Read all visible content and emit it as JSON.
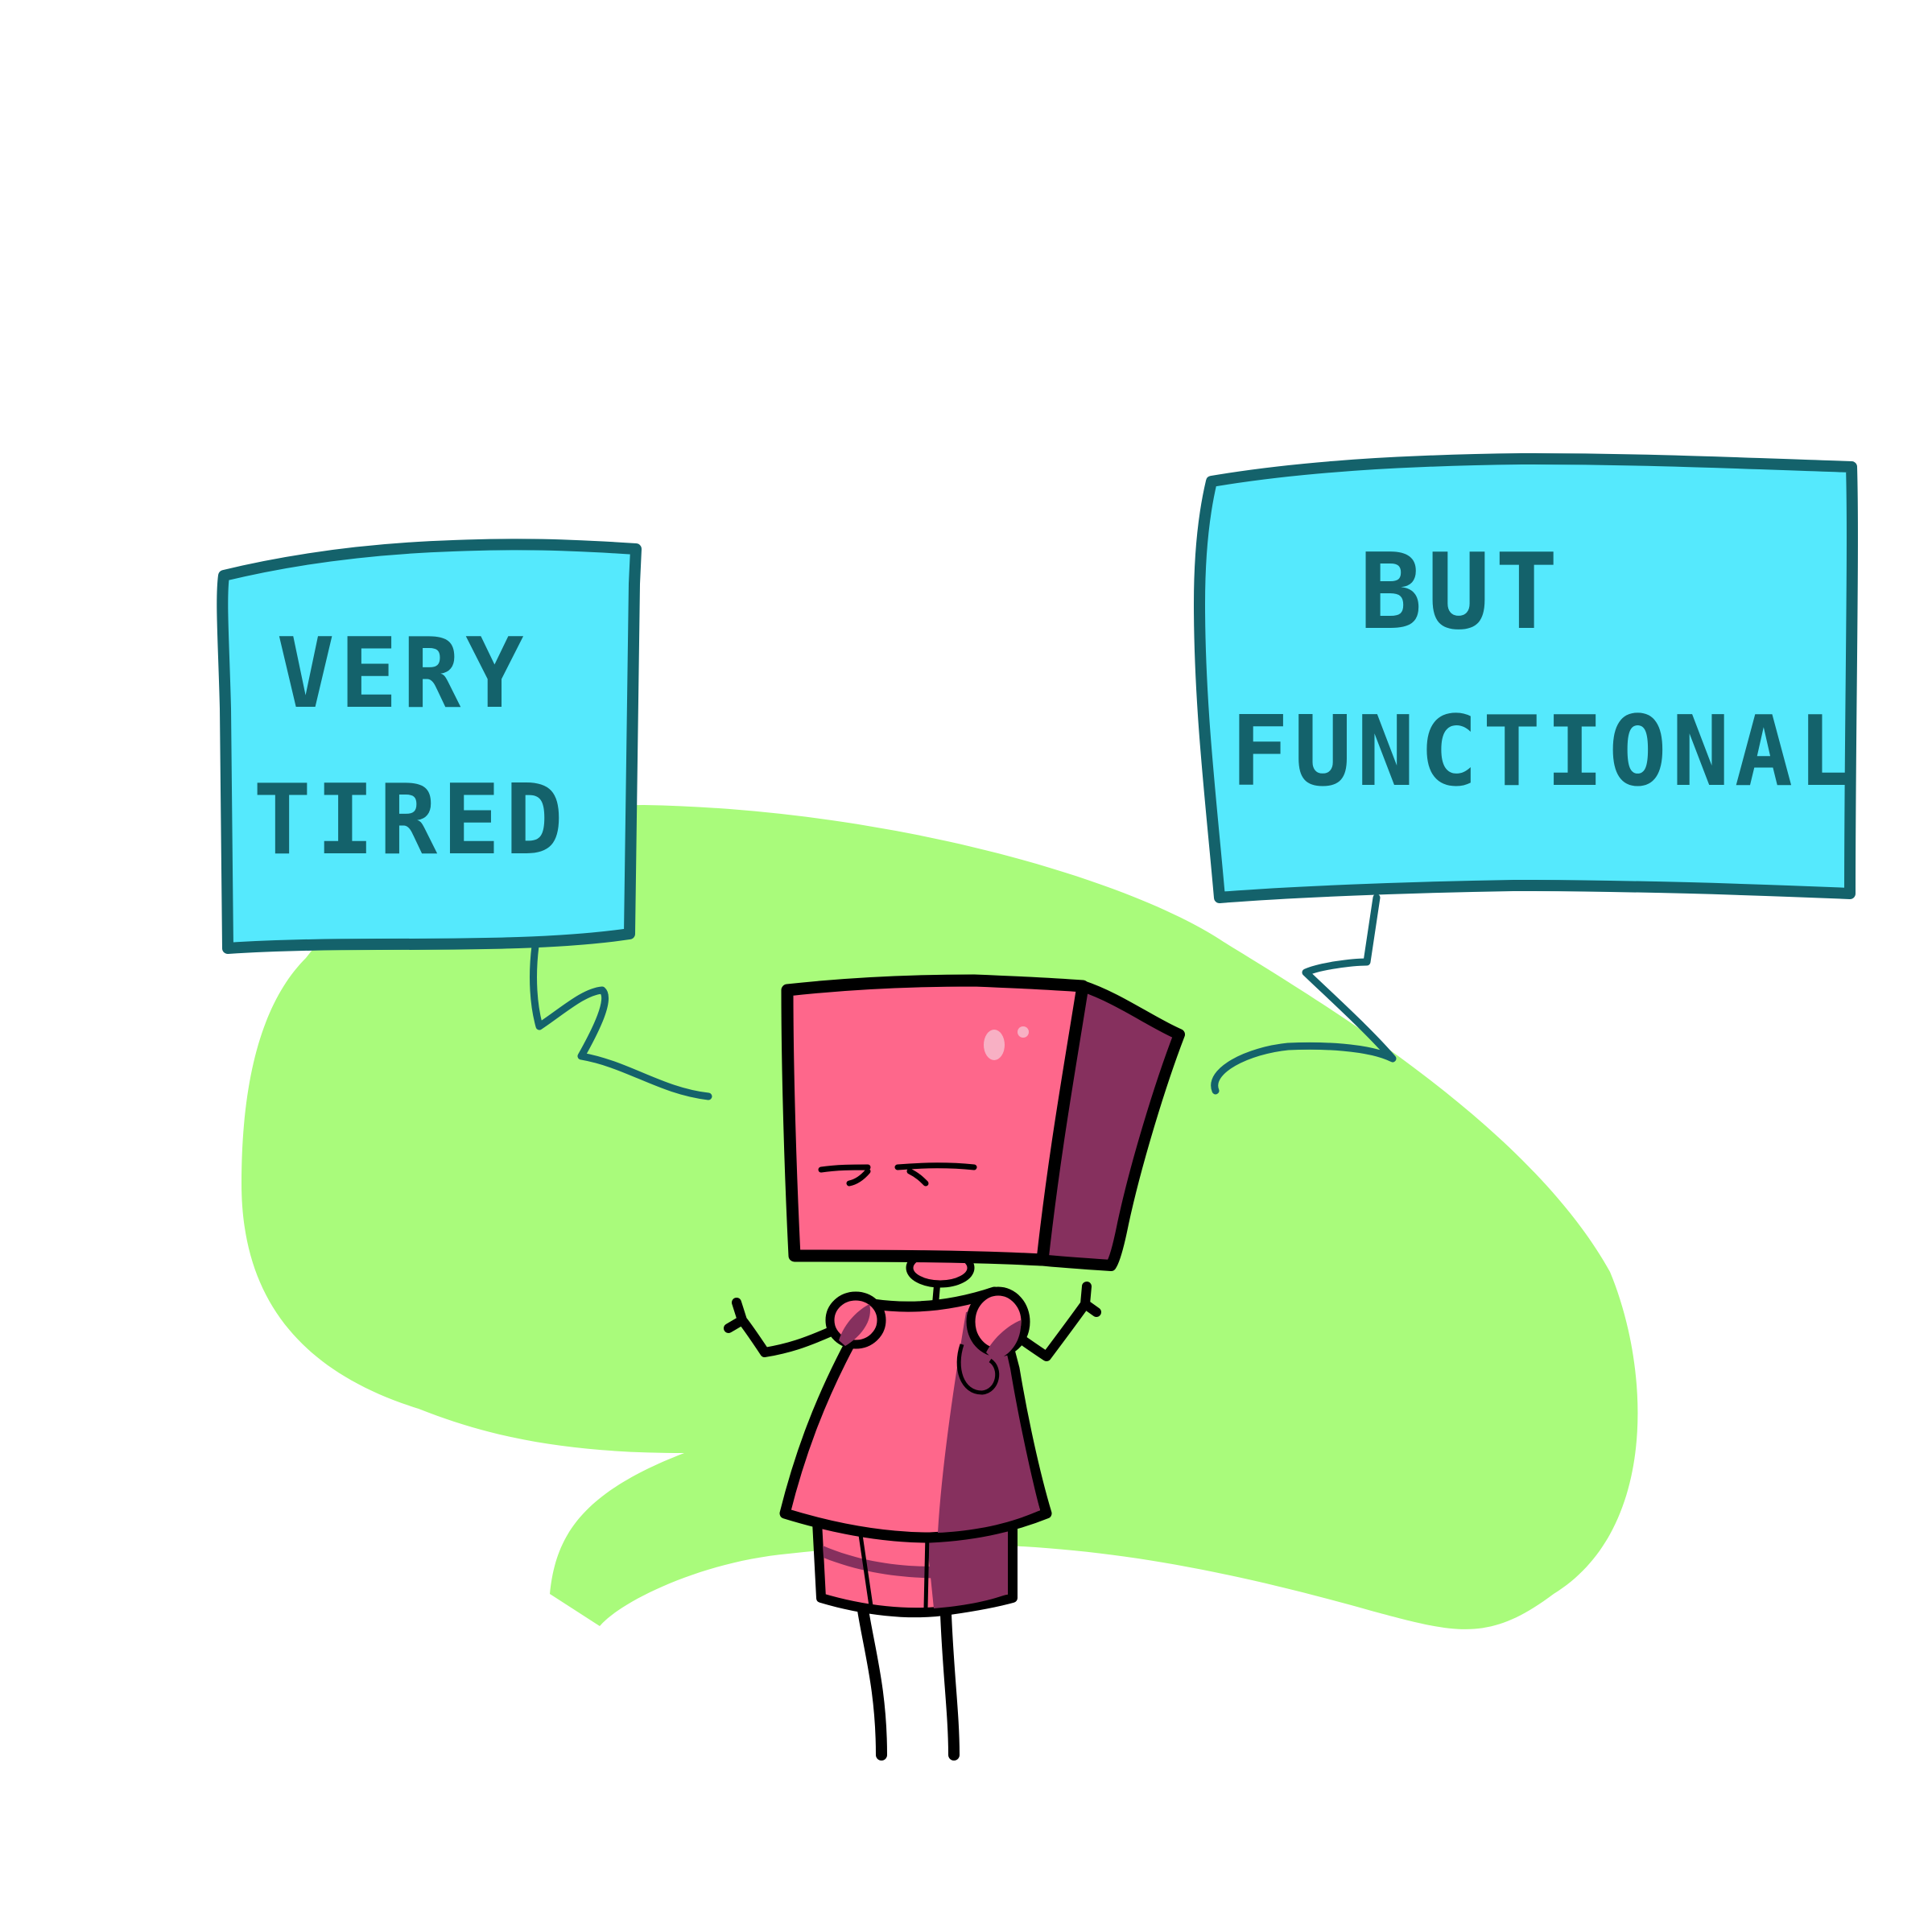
{
  "bubbles": {
    "left": {
      "line1": "VERY",
      "line2": "TIRED"
    },
    "right": {
      "line1": "BUT",
      "line2": "FUNCTIONAL"
    }
  },
  "colors": {
    "background": "#ffffff",
    "blob": "#a9fb7b",
    "bubble_fill": "#55e9fd",
    "bubble_outline": "#14626b",
    "robot_pink": "#fe678b",
    "robot_shadow": "#86305e",
    "outline": "#000000",
    "highlight": "#f8b0c4"
  },
  "icons": {
    "character": "tired-box-robot-icon",
    "left_tail": "speech-tail-icon",
    "right_tail": "speech-tail-icon"
  }
}
